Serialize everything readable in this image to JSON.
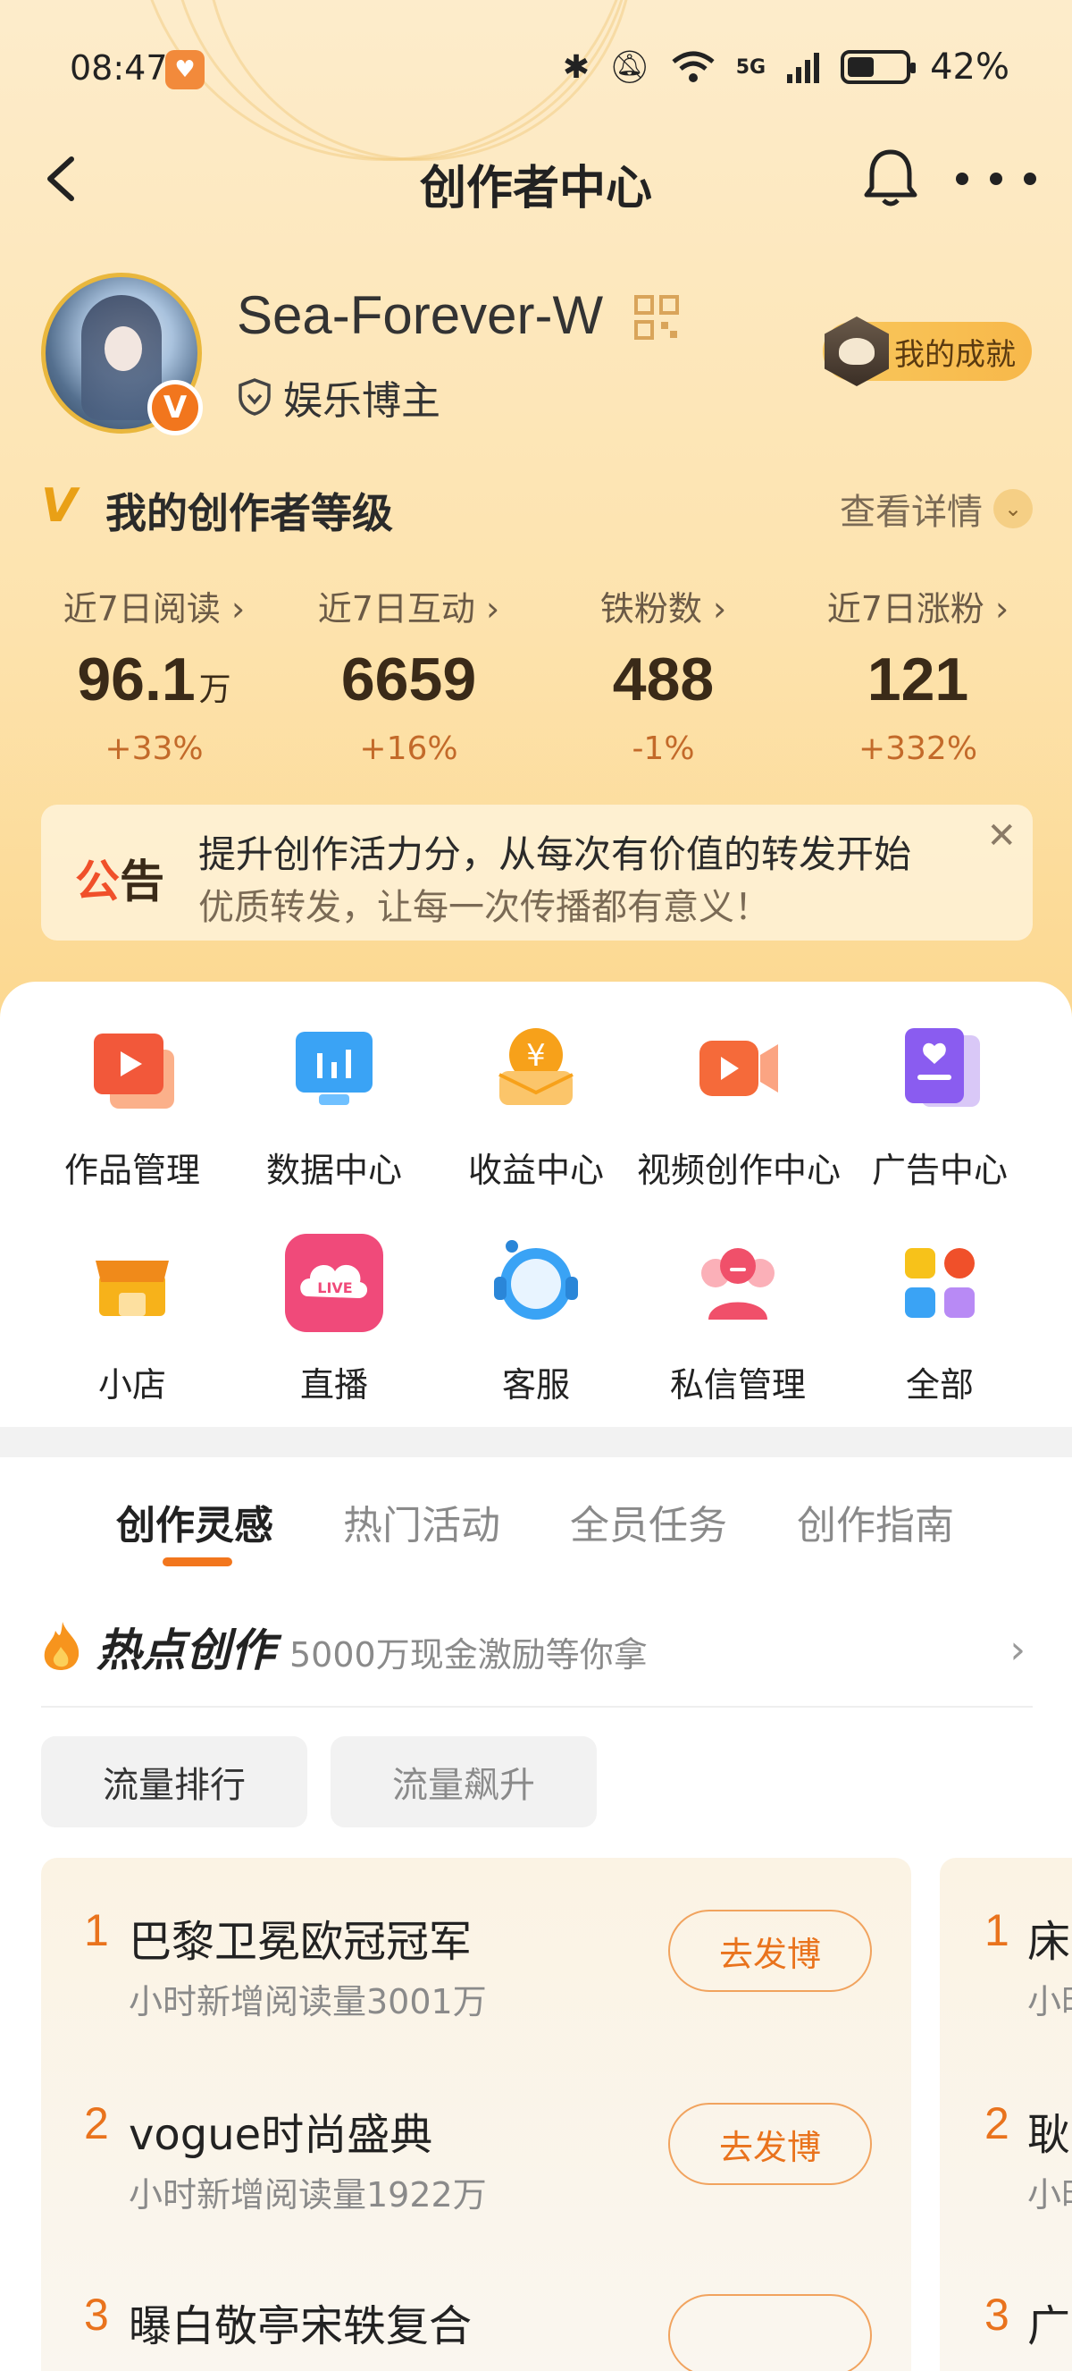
{
  "status_bar": {
    "time": "08:47",
    "battery": "42%",
    "network": "5G"
  },
  "header": {
    "title": "创作者中心"
  },
  "profile": {
    "username": "Sea-Forever-W",
    "role": "娱乐博主",
    "badge": "V",
    "achievement_label": "我的成就"
  },
  "level": {
    "title": "我的创作者等级",
    "detail_label": "查看详情"
  },
  "stats": [
    {
      "label": "近7日阅读",
      "value": "96.1",
      "unit": "万",
      "change": "+33%"
    },
    {
      "label": "近7日互动",
      "value": "6659",
      "unit": "",
      "change": "+16%"
    },
    {
      "label": "铁粉数",
      "value": "488",
      "unit": "",
      "change": "-1%"
    },
    {
      "label": "近7日涨粉",
      "value": "121",
      "unit": "",
      "change": "+332%"
    }
  ],
  "notice": {
    "tag_first": "公",
    "tag_second": "告",
    "line1": "提升创作活力分，从每次有价值的转发开始",
    "line2": "优质转发，让每一次传播都有意义！"
  },
  "grid": [
    {
      "label": "作品管理",
      "icon": "works-icon"
    },
    {
      "label": "数据中心",
      "icon": "data-icon"
    },
    {
      "label": "收益中心",
      "icon": "income-icon"
    },
    {
      "label": "视频创作中心",
      "icon": "video-icon"
    },
    {
      "label": "广告中心",
      "icon": "ad-icon"
    },
    {
      "label": "小店",
      "icon": "shop-icon"
    },
    {
      "label": "直播",
      "icon": "live-icon",
      "badge_text": "LIVE"
    },
    {
      "label": "客服",
      "icon": "support-icon"
    },
    {
      "label": "私信管理",
      "icon": "message-icon"
    },
    {
      "label": "全部",
      "icon": "all-icon"
    }
  ],
  "tabs": [
    "创作灵感",
    "热门活动",
    "全员任务",
    "创作指南"
  ],
  "hot": {
    "title": "热点创作",
    "subtitle": "5000万现金激励等你拿"
  },
  "chips": [
    "流量排行",
    "流量飙升"
  ],
  "rank_main": [
    {
      "num": "1",
      "name": "巴黎卫冕欧冠冠军",
      "meta": "小时新增阅读量3001万",
      "button": "去发博"
    },
    {
      "num": "2",
      "name": "vogue时尚盛典",
      "meta": "小时新增阅读量1922万",
      "button": "去发博"
    },
    {
      "num": "3",
      "name": "曝白敬亭宋轶复合",
      "meta": "",
      "button": ""
    }
  ],
  "rank_peek": [
    {
      "num": "1",
      "name": "床",
      "meta": "小时"
    },
    {
      "num": "2",
      "name": "耿",
      "meta": "小时"
    },
    {
      "num": "3",
      "name": "广",
      "meta": ""
    }
  ],
  "colors": {
    "accent": "#f2761d",
    "gold": "#e9a016",
    "notice_red": "#f0502a"
  }
}
